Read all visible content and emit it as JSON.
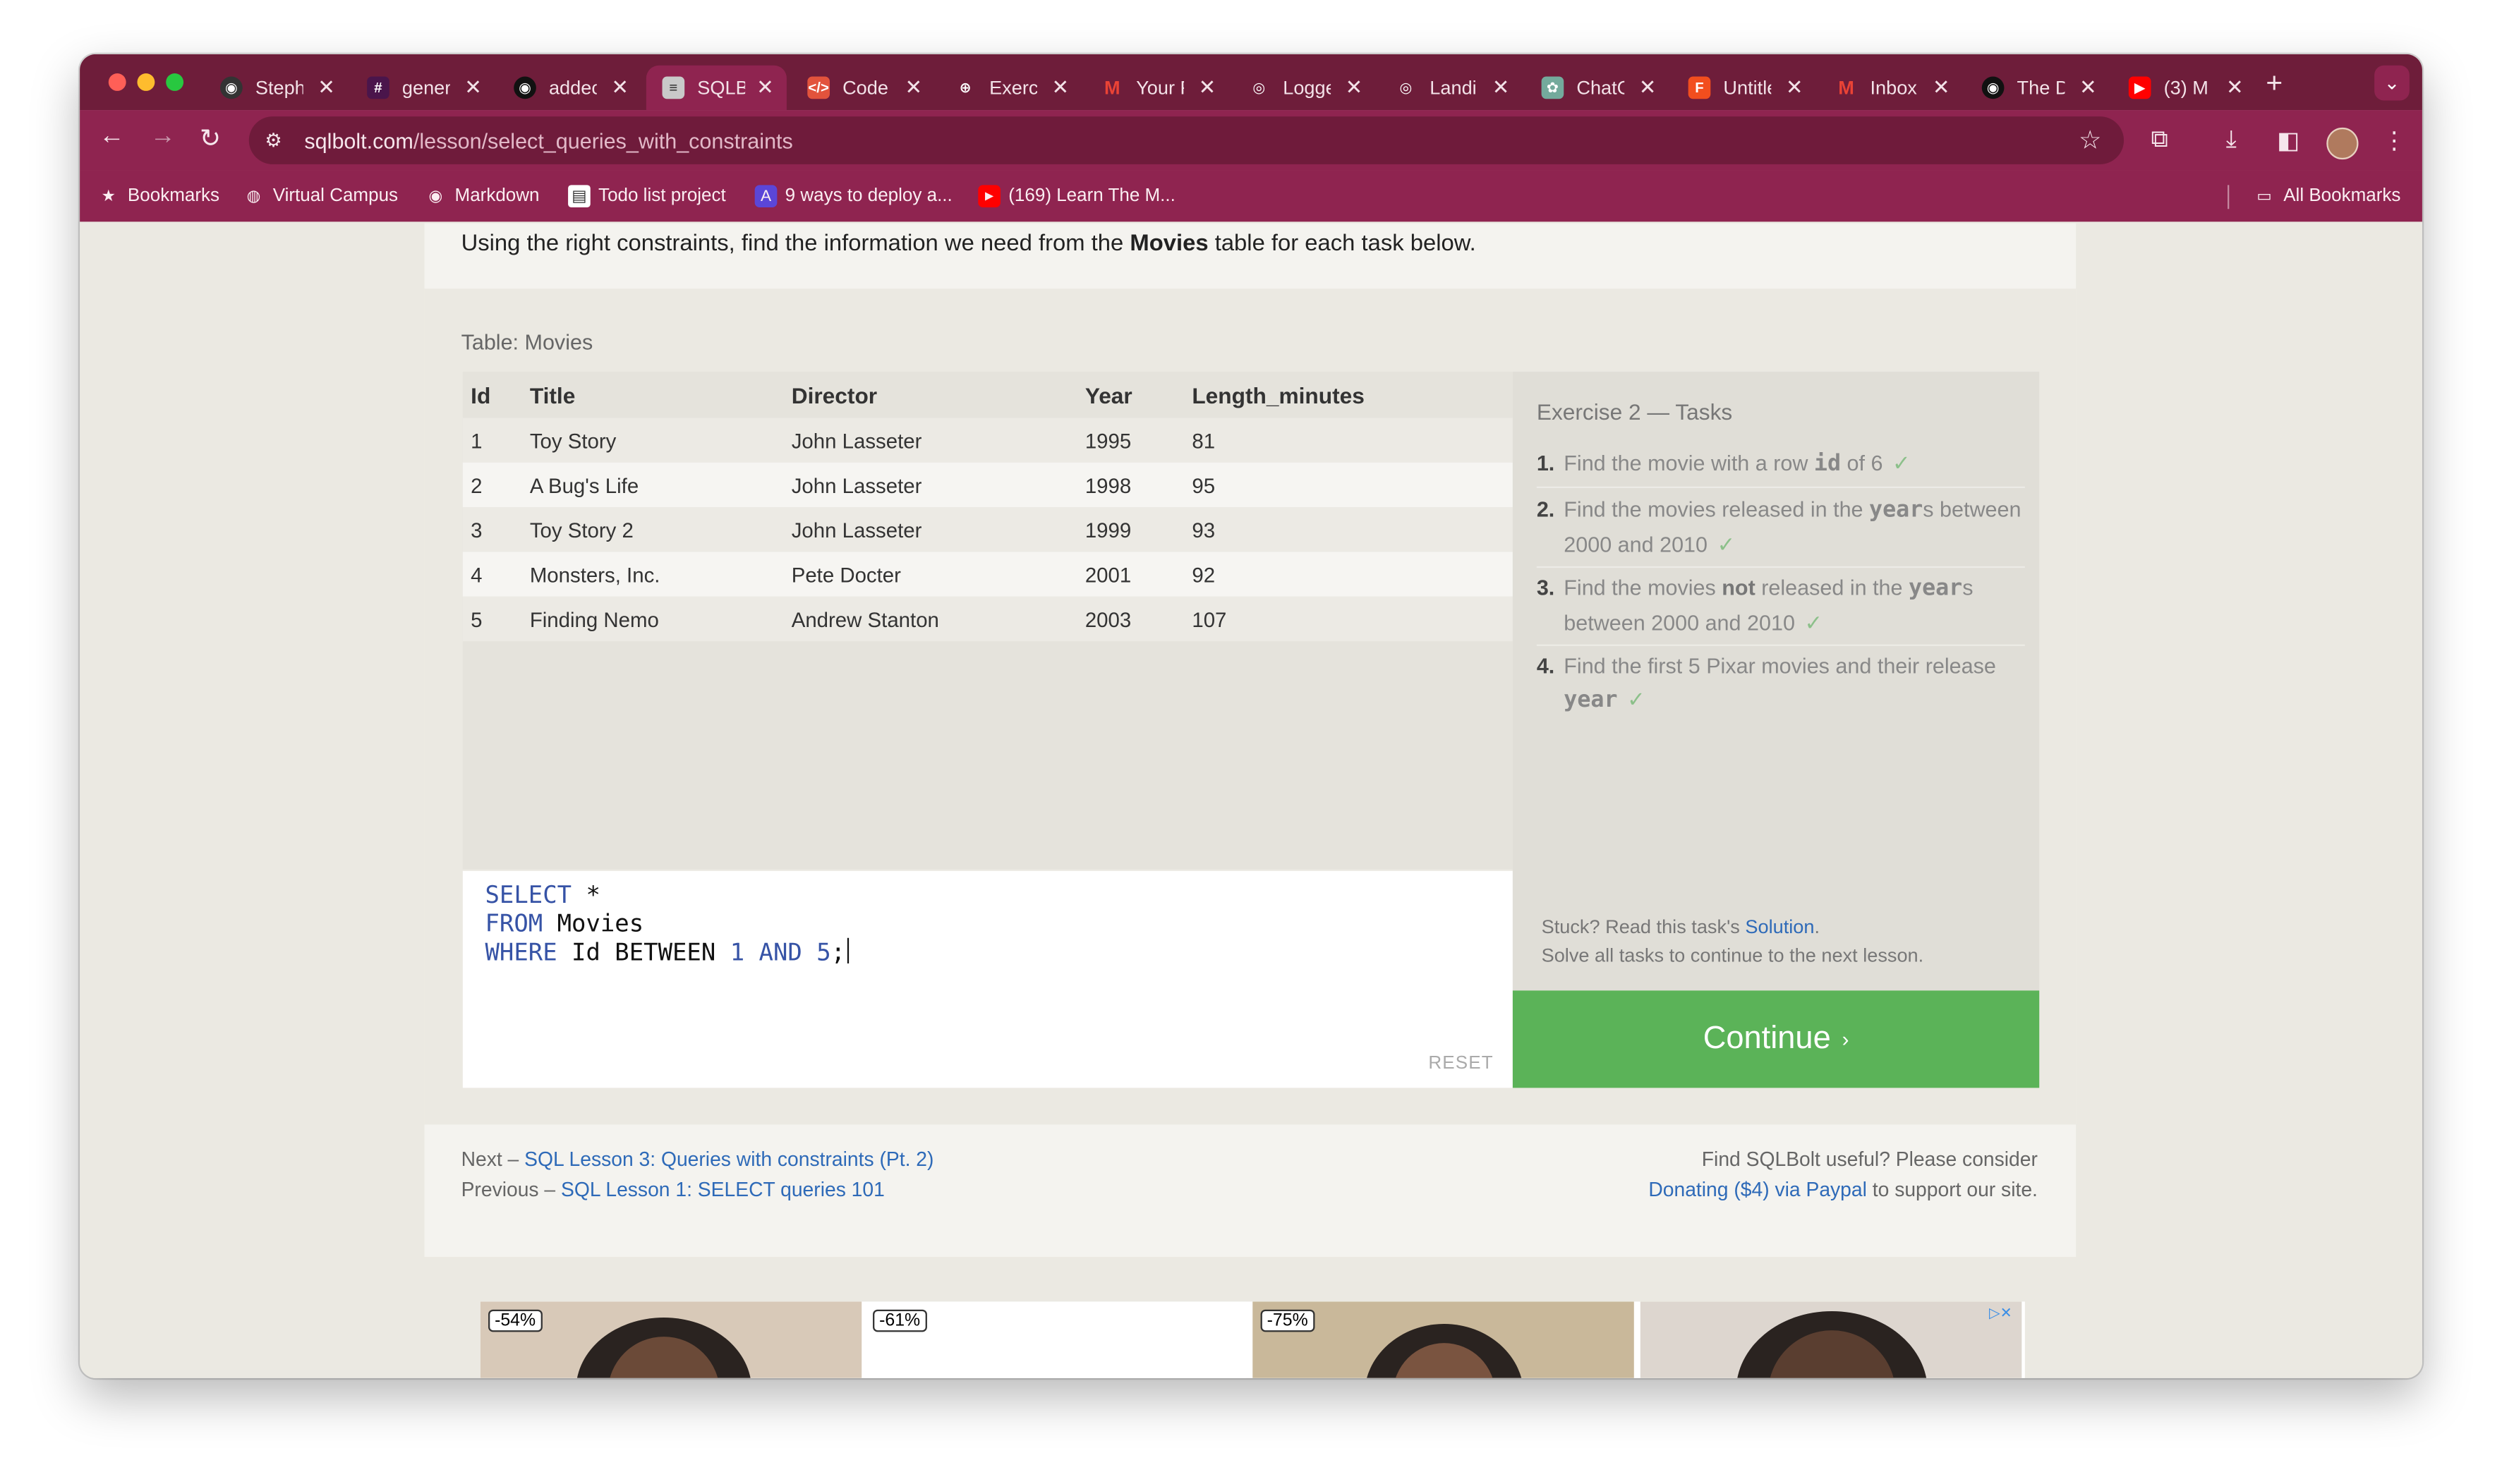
{
  "browser": {
    "tabs": [
      {
        "title": "Steph",
        "icon": "github-icon"
      },
      {
        "title": "gener",
        "icon": "slack-icon"
      },
      {
        "title": "addec",
        "icon": "github-icon"
      },
      {
        "title": "SQLB",
        "icon": "database-icon",
        "active": true
      },
      {
        "title": "Code",
        "icon": "codecademy-icon"
      },
      {
        "title": "Exerc",
        "icon": "globe-icon"
      },
      {
        "title": "Your F",
        "icon": "gmail-icon"
      },
      {
        "title": "Logge",
        "icon": "circle-icon"
      },
      {
        "title": "Landi",
        "icon": "circle-icon"
      },
      {
        "title": "ChatG",
        "icon": "chatgpt-icon"
      },
      {
        "title": "Untitle",
        "icon": "figma-icon"
      },
      {
        "title": "Inbox",
        "icon": "gmail-icon"
      },
      {
        "title": "The D",
        "icon": "github-icon"
      },
      {
        "title": "(3) M",
        "icon": "youtube-icon"
      }
    ],
    "url_host": "sqlbolt.com",
    "url_path": "/lesson/select_queries_with_constraints",
    "bookmarks": [
      {
        "label": "Bookmarks",
        "icon": "star-icon"
      },
      {
        "label": "Virtual Campus",
        "icon": "globe-icon"
      },
      {
        "label": "Markdown",
        "icon": "github-icon"
      },
      {
        "label": "Todo list project",
        "icon": "page-icon"
      },
      {
        "label": "9 ways to deploy a...",
        "icon": "astro-icon"
      },
      {
        "label": "(169) Learn The M...",
        "icon": "youtube-icon"
      }
    ],
    "all_bookmarks": "All Bookmarks"
  },
  "lesson": {
    "intro_pre": "Using the right constraints, find the information we need from the ",
    "intro_bold": "Movies",
    "intro_post": " table for each task below.",
    "table_caption": "Table: Movies",
    "columns": [
      "Id",
      "Title",
      "Director",
      "Year",
      "Length_minutes"
    ],
    "rows": [
      [
        "1",
        "Toy Story",
        "John Lasseter",
        "1995",
        "81"
      ],
      [
        "2",
        "A Bug's Life",
        "John Lasseter",
        "1998",
        "95"
      ],
      [
        "3",
        "Toy Story 2",
        "John Lasseter",
        "1999",
        "93"
      ],
      [
        "4",
        "Monsters, Inc.",
        "Pete Docter",
        "2001",
        "92"
      ],
      [
        "5",
        "Finding Nemo",
        "Andrew Stanton",
        "2003",
        "107"
      ]
    ],
    "query": {
      "kw_select": "SELECT",
      "star": " *",
      "kw_from": "FROM",
      "table": " Movies",
      "kw_where": "WHERE",
      "cond": " Id BETWEEN ",
      "n1": "1",
      "kw_and": "AND",
      "n2": "5",
      "end": ";"
    },
    "reset_label": "RESET",
    "tasks_title": "Exercise 2 — Tasks",
    "tasks": [
      {
        "num": "1.",
        "pre": "Find the movie with a row ",
        "code": "id",
        "post": " of 6",
        "check": "✓"
      },
      {
        "num": "2.",
        "pre": "Find the movies released in the ",
        "code": "year",
        "post": "s between 2000 and 2010",
        "check": "✓"
      },
      {
        "num": "3.",
        "pre": "Find the movies ",
        "bold": "not",
        "mid": " released in the ",
        "code": "year",
        "post": "s between 2000 and 2010",
        "check": "✓"
      },
      {
        "num": "4.",
        "pre": "Find the first 5 Pixar movies and their release ",
        "code": "year",
        "post": "",
        "check": "✓"
      }
    ],
    "stuck_text": "Stuck? Read this task's ",
    "solution_link": "Solution",
    "stuck_end": ".",
    "solve_all": "Solve all tasks to continue to the next lesson.",
    "continue_label": "Continue",
    "continue_arrow": "›"
  },
  "footer": {
    "next_prefix": "Next – ",
    "next_link": "SQL Lesson 3: Queries with constraints (Pt. 2)",
    "prev_prefix": "Previous – ",
    "prev_link": "SQL Lesson 1: SELECT queries 101",
    "consider": "Find SQLBolt useful? Please consider",
    "donate_link": "Donating ($4) via Paypal",
    "donate_suffix": " to support our site."
  },
  "ad": {
    "badges": [
      "-54%",
      "-61%",
      "-75%"
    ]
  }
}
